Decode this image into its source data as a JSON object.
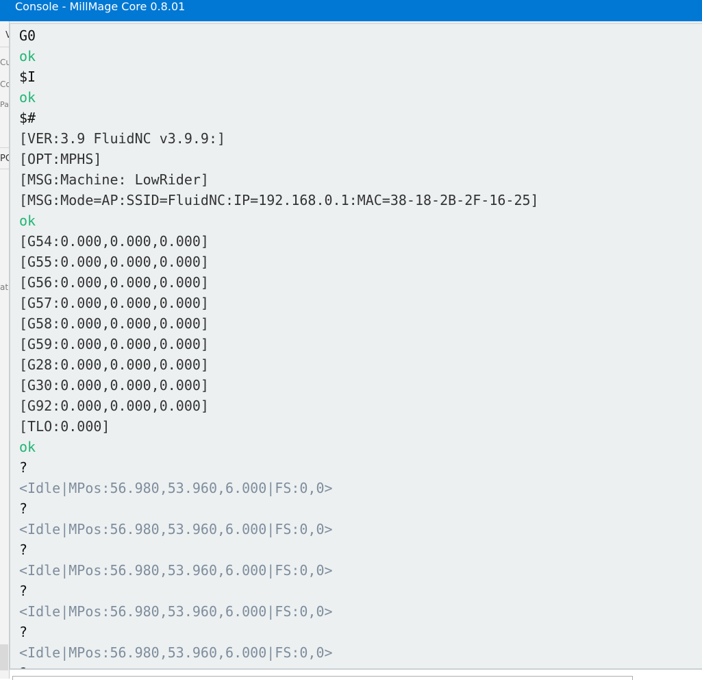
{
  "window": {
    "title": "Console - MillMage Core 0.8.01"
  },
  "background_fragments": [
    "V",
    "Cu",
    "Co",
    "Pa",
    "PC",
    "at"
  ],
  "console": {
    "lines": [
      {
        "text": "G0",
        "kind": "cmd"
      },
      {
        "text": "ok",
        "kind": "ok"
      },
      {
        "text": "$I",
        "kind": "cmd"
      },
      {
        "text": "ok",
        "kind": "ok"
      },
      {
        "text": "$#",
        "kind": "cmd"
      },
      {
        "text": "[VER:3.9 FluidNC v3.9.9:]",
        "kind": "resp"
      },
      {
        "text": "[OPT:MPHS]",
        "kind": "resp"
      },
      {
        "text": "[MSG:Machine: LowRider]",
        "kind": "resp"
      },
      {
        "text": "[MSG:Mode=AP:SSID=FluidNC:IP=192.168.0.1:MAC=38-18-2B-2F-16-25]",
        "kind": "resp"
      },
      {
        "text": "ok",
        "kind": "ok"
      },
      {
        "text": "[G54:0.000,0.000,0.000]",
        "kind": "resp"
      },
      {
        "text": "[G55:0.000,0.000,0.000]",
        "kind": "resp"
      },
      {
        "text": "[G56:0.000,0.000,0.000]",
        "kind": "resp"
      },
      {
        "text": "[G57:0.000,0.000,0.000]",
        "kind": "resp"
      },
      {
        "text": "[G58:0.000,0.000,0.000]",
        "kind": "resp"
      },
      {
        "text": "[G59:0.000,0.000,0.000]",
        "kind": "resp"
      },
      {
        "text": "[G28:0.000,0.000,0.000]",
        "kind": "resp"
      },
      {
        "text": "[G30:0.000,0.000,0.000]",
        "kind": "resp"
      },
      {
        "text": "[G92:0.000,0.000,0.000]",
        "kind": "resp"
      },
      {
        "text": "[TLO:0.000]",
        "kind": "resp"
      },
      {
        "text": "ok",
        "kind": "ok"
      },
      {
        "text": "?",
        "kind": "cmd"
      },
      {
        "text": "<Idle|MPos:56.980,53.960,6.000|FS:0,0>",
        "kind": "status"
      },
      {
        "text": "?",
        "kind": "cmd"
      },
      {
        "text": "<Idle|MPos:56.980,53.960,6.000|FS:0,0>",
        "kind": "status"
      },
      {
        "text": "?",
        "kind": "cmd"
      },
      {
        "text": "<Idle|MPos:56.980,53.960,6.000|FS:0,0>",
        "kind": "status"
      },
      {
        "text": "?",
        "kind": "cmd"
      },
      {
        "text": "<Idle|MPos:56.980,53.960,6.000|FS:0,0>",
        "kind": "status"
      },
      {
        "text": "?",
        "kind": "cmd"
      },
      {
        "text": "<Idle|MPos:56.980,53.960,6.000|FS:0,0>",
        "kind": "status"
      },
      {
        "text": "?",
        "kind": "cmd"
      }
    ]
  },
  "colors": {
    "titlebar": "#0078d4",
    "command": "#111111",
    "ok": "#22b573",
    "response": "#333333",
    "status": "#7f8d9c",
    "console_bg": "#ecf0f1"
  }
}
